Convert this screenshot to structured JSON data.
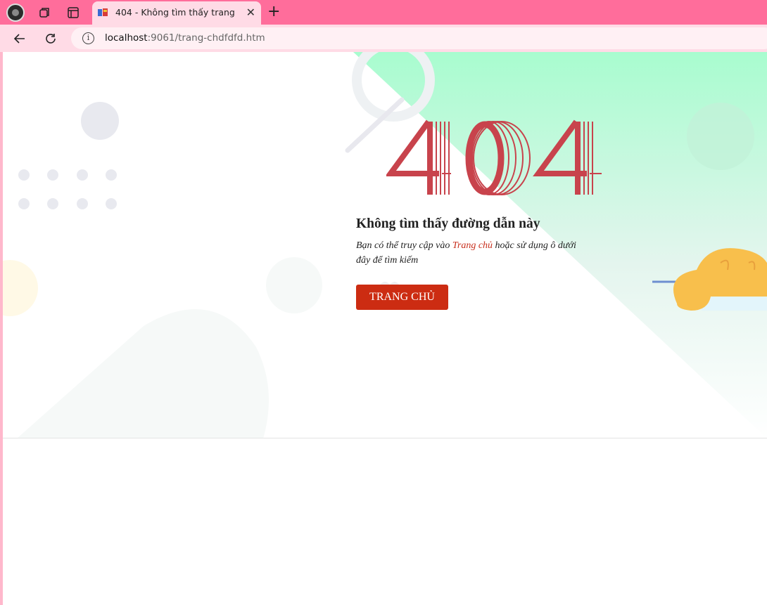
{
  "browser": {
    "tab": {
      "title": "404 - Không tìm thấy trang",
      "close": "✕"
    },
    "new_tab": "+",
    "address": {
      "host": "localhost",
      "path": ":9061/trang-chdfdfd.htm"
    }
  },
  "page": {
    "error_code": "404",
    "heading": "Không tìm thấy đường dẫn này",
    "desc_before": "Bạn có thể truy cập vào ",
    "desc_link": "Trang chủ",
    "desc_after": " hoặc sử dụng ô dưới đây để tìm kiếm",
    "home_button": "TRANG CHỦ"
  },
  "colors": {
    "tab_strip": "#ff6d9b",
    "toolbar": "#ffdbe6",
    "code_red": "#c8434c",
    "button": "#cc2c12",
    "link": "#c8301e",
    "mint": "#a8fccf"
  }
}
